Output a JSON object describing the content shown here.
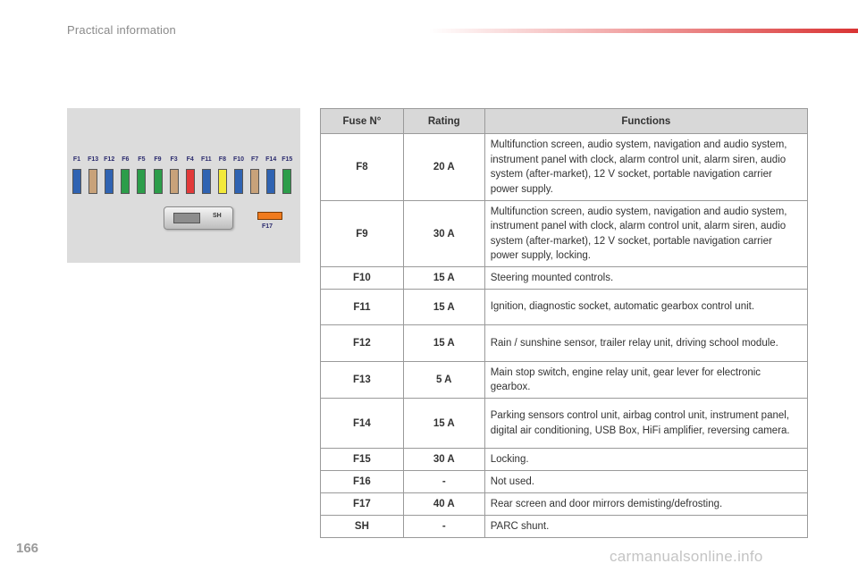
{
  "header": {
    "title": "Practical information"
  },
  "page_number": "166",
  "watermark": "carmanualsonline.info",
  "fusebox": {
    "fuses": [
      {
        "label": "F1",
        "color": "#2f63b2"
      },
      {
        "label": "F13",
        "color": "#c8a27a"
      },
      {
        "label": "F12",
        "color": "#2f63b2"
      },
      {
        "label": "F6",
        "color": "#2c9d4a"
      },
      {
        "label": "F5",
        "color": "#2c9d4a"
      },
      {
        "label": "F9",
        "color": "#2c9d4a"
      },
      {
        "label": "F3",
        "color": "#c8a27a"
      },
      {
        "label": "F4",
        "color": "#e23a3a"
      },
      {
        "label": "F11",
        "color": "#2f63b2"
      },
      {
        "label": "F8",
        "color": "#f3e93a"
      },
      {
        "label": "F10",
        "color": "#2f63b2"
      },
      {
        "label": "F7",
        "color": "#c8a27a"
      },
      {
        "label": "F14",
        "color": "#2f63b2"
      },
      {
        "label": "F15",
        "color": "#2c9d4a"
      }
    ],
    "shunt_label": "SH",
    "f17_label": "F17",
    "f17_color": "#f07b1e"
  },
  "table": {
    "headers": {
      "fuse": "Fuse N°",
      "rating": "Rating",
      "functions": "Functions"
    },
    "rows": [
      {
        "fuse": "F8",
        "rating": "20 A",
        "functions": "Multifunction screen, audio system, navigation and audio system, instrument panel with clock, alarm control unit, alarm siren, audio system (after-market), 12 V socket, portable navigation carrier power supply."
      },
      {
        "fuse": "F9",
        "rating": "30 A",
        "functions": "Multifunction screen, audio system, navigation and audio system, instrument panel with clock, alarm control unit, alarm siren, audio system (after-market), 12 V socket, portable navigation carrier power supply, locking."
      },
      {
        "fuse": "F10",
        "rating": "15 A",
        "functions": "Steering mounted controls."
      },
      {
        "fuse": "F11",
        "rating": "15 A",
        "functions": "Ignition, diagnostic socket, automatic gearbox control unit."
      },
      {
        "fuse": "F12",
        "rating": "15 A",
        "functions": "Rain / sunshine sensor, trailer relay unit, driving school module."
      },
      {
        "fuse": "F13",
        "rating": "5 A",
        "functions": "Main stop switch, engine relay unit, gear lever for electronic gearbox."
      },
      {
        "fuse": "F14",
        "rating": "15 A",
        "functions": "Parking sensors control unit, airbag control unit, instrument panel, digital air conditioning, USB Box, HiFi amplifier, reversing camera."
      },
      {
        "fuse": "F15",
        "rating": "30 A",
        "functions": "Locking."
      },
      {
        "fuse": "F16",
        "rating": "-",
        "functions": "Not used."
      },
      {
        "fuse": "F17",
        "rating": "40 A",
        "functions": "Rear screen and door mirrors demisting/defrosting."
      },
      {
        "fuse": "SH",
        "rating": "-",
        "functions": "PARC shunt."
      }
    ]
  }
}
